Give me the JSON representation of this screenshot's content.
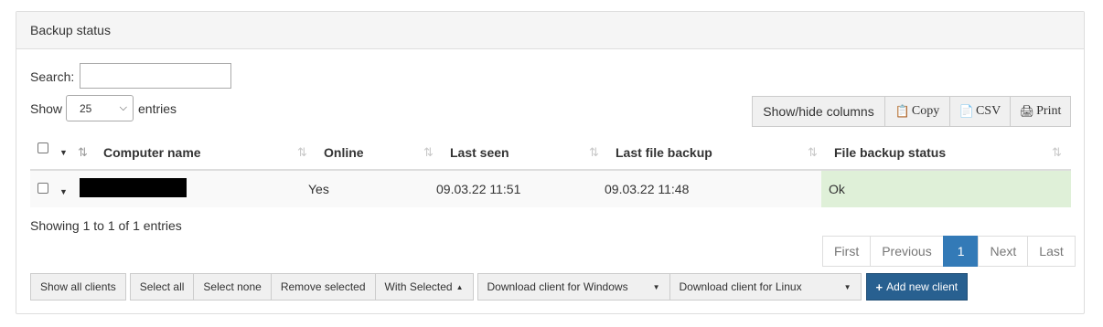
{
  "panel": {
    "title": "Backup status"
  },
  "search": {
    "label": "Search:",
    "value": ""
  },
  "length": {
    "show_label": "Show",
    "selected": "25",
    "entries_label": "entries"
  },
  "top_buttons": {
    "show_hide": "Show/hide columns",
    "copy": "Copy",
    "csv": "CSV",
    "print": "Print"
  },
  "table": {
    "columns": [
      "Computer name",
      "Online",
      "Last seen",
      "Last file backup",
      "File backup status"
    ],
    "rows": [
      {
        "computer_name": "",
        "online": "Yes",
        "last_seen": "09.03.22 11:51",
        "last_file_backup": "09.03.22 11:48",
        "file_backup_status": "Ok"
      }
    ]
  },
  "info": "Showing 1 to 1 of 1 entries",
  "pagination": {
    "first": "First",
    "previous": "Previous",
    "current": "1",
    "next": "Next",
    "last": "Last"
  },
  "bottom": {
    "show_all": "Show all clients",
    "select_all": "Select all",
    "select_none": "Select none",
    "remove_selected": "Remove selected",
    "with_selected": "With Selected",
    "download_windows": "Download client for Windows",
    "download_linux": "Download client for Linux",
    "add_new": "Add new client"
  },
  "colors": {
    "primary": "#286090",
    "active_page": "#337ab7",
    "ok_status": "#dff0d8"
  }
}
